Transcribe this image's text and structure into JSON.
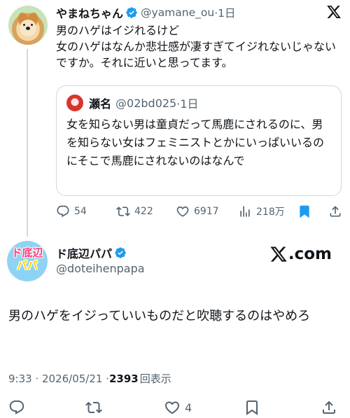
{
  "colors": {
    "accent": "#1d9bf0",
    "muted": "#536471",
    "text": "#0f1419",
    "border": "#cfd9de"
  },
  "tweet1": {
    "name": "やまねちゃん",
    "handle": "@yamane_ou",
    "time": "·1日",
    "text": "男のハゲはイジれるけど\n女のハゲはなんか悲壮感が凄すぎてイジれないじゃないですか。それに近いと思ってます。",
    "quote": {
      "name": "瀬名",
      "handle": "@02bd025",
      "time": "·1日",
      "text": "女を知らない男は童貞だって馬鹿にされるのに、男を知らない女はフェミニストとかにいっぱいいるのにそこで馬鹿にされないのはなんで"
    },
    "actions": {
      "replies": "54",
      "reposts": "422",
      "likes": "6917",
      "views": "218万"
    }
  },
  "tweet2": {
    "name": "ド底辺パパ",
    "handle": "@doteihenpapa",
    "avatar_text_top": "ド底辺",
    "avatar_text_bottom": "パパ",
    "site_label": ".com",
    "text": "男のハゲをイジっていいものだと吹聴するのはやめろ",
    "time": "9:33 · 2026/05/21 · ",
    "view_count": "2393",
    "view_label": "回表示",
    "actions": {
      "likes": "4"
    }
  }
}
